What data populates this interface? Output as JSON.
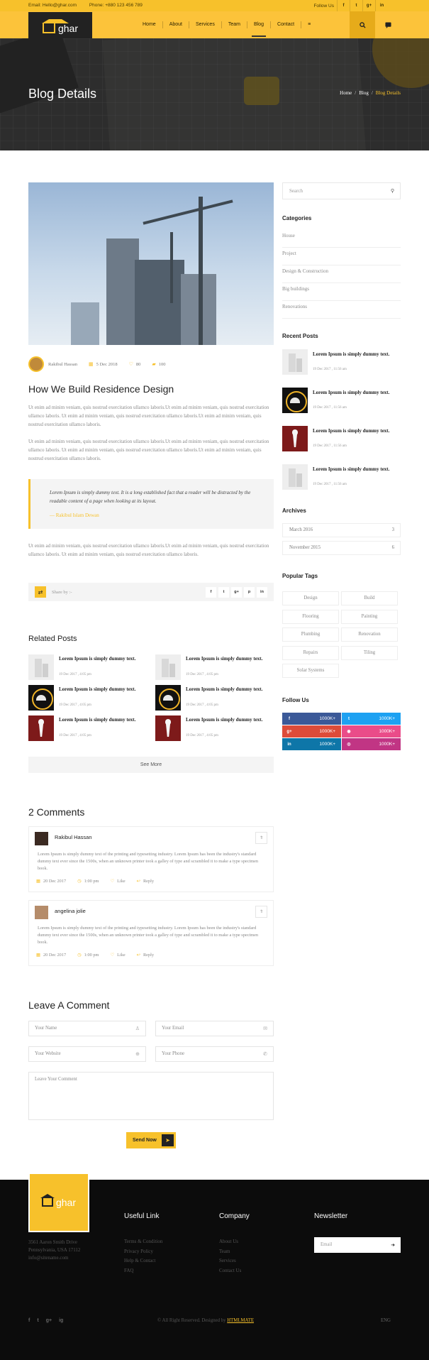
{
  "topbar": {
    "email": "Email: Hello@ghar.com",
    "phone": "Phone: +880 123 456 789",
    "follow": "Follow Us",
    "social": [
      "f",
      "t",
      "g+",
      "in"
    ]
  },
  "brand": {
    "name": "ghar"
  },
  "nav": {
    "items": [
      "Home",
      "About",
      "Services",
      "Team",
      "Blog",
      "Contact"
    ],
    "active": "Blog",
    "more": "≡"
  },
  "hero": {
    "title": "Blog Details",
    "crumbs": [
      "Home",
      "Blog",
      "Blog Details"
    ]
  },
  "post": {
    "author": "Rakibul Hassan",
    "date": "5 Dec 2018",
    "likes": "80",
    "comments": "100",
    "title": "How We Build Residence Design",
    "p1": "Ut enim ad minim veniam, quis nostrud exercitation ullamco laboris.Ut enim ad minim veniam, quis nostrud exercitation ullamco laboris. Ut enim ad minim veniam, quis nostrud exercitation ullamco laboris.Ut enim ad minim veniam, quis nostrud exercitation ullamco laboris.",
    "p2": "Ut enim ad minim veniam, quis nostrud exercitation ullamco laboris.Ut enim ad minim veniam, quis nostrud exercitation ullamco laboris. Ut enim ad minim veniam, quis nostrud exercitation ullamco laboris.Ut enim ad minim veniam, quis nostrud exercitation ullamco laboris.",
    "quote": "Lorem Ipsum is simply dummy text. It is a long established fact that a reader will be distracted by the readable content of a page when looking at its layout.",
    "quote_by": "Rakibul Islam Dewan",
    "p3": "Ut enim ad minim veniam, quis nostrud exercitation ullamco laboris.Ut enim ad minim veniam, quis nostrud exercitation ullamco laboris. Ut enim ad minim veniam, quis nostrud exercitation ullamco laboris.",
    "share_label": "Share by :-",
    "share": [
      "f",
      "t",
      "g+",
      "p",
      "in"
    ]
  },
  "related": {
    "heading": "Related Posts",
    "items": [
      {
        "title": "Lorem Ipsum is simply dummy text.",
        "date": "19 Dec 2017 , 4:05 pm",
        "thumb": "building"
      },
      {
        "title": "Lorem Ipsum is simply dummy text.",
        "date": "19 Dec 2017 , 4:05 pm",
        "thumb": "building"
      },
      {
        "title": "Lorem Ipsum is simply dummy text.",
        "date": "19 Dec 2017 , 4:05 pm",
        "thumb": "hardhat"
      },
      {
        "title": "Lorem Ipsum is simply dummy text.",
        "date": "19 Dec 2017 , 4:05 pm",
        "thumb": "hardhat"
      },
      {
        "title": "Lorem Ipsum is simply dummy text.",
        "date": "19 Dec 2017 , 4:05 pm",
        "thumb": "torch"
      },
      {
        "title": "Lorem Ipsum is simply dummy text.",
        "date": "19 Dec 2017 , 4:05 pm",
        "thumb": "torch"
      }
    ],
    "see_more": "See More"
  },
  "comments": {
    "heading": "2 Comments",
    "items": [
      {
        "name": "Rakibul Hassan",
        "text": "Lorem Ipsum is simply dummy text of the printing and typesetting industry. Lorem Ipsum has been the industry's standard dummy text ever since the 1500s, when an unknown printer took a galley of type and scrambled it to make a type specimen book.",
        "date": "20 Dec 2017",
        "time": "1:00 pm",
        "like": "Like",
        "reply": "Reply"
      },
      {
        "name": "angelina jolie",
        "text": "Lorem Ipsum is simply dummy text of the printing and typesetting industry. Lorem Ipsum has been the industry's standard dummy text ever since the 1500s, when an unknown printer took a galley of type and scrambled it to make a type specimen book.",
        "date": "20 Dec 2017",
        "time": "1:00 pm",
        "like": "Like",
        "reply": "Reply"
      }
    ]
  },
  "form": {
    "heading": "Leave A Comment",
    "name": "Your Name",
    "email": "Your Email",
    "website": "Your Website",
    "phone": "Your Phone",
    "comment": "Leave Your Comment",
    "send": "Send Now"
  },
  "sidebar": {
    "search": "Search",
    "categories_heading": "Categories",
    "categories": [
      "House",
      "Project",
      "Design & Construction",
      "Big buildings",
      "Renovations"
    ],
    "recent_heading": "Recent Posts",
    "recent": [
      {
        "title": "Lorem Ipsum is simply dummy text.",
        "date": "19 Dec 2017 , 11:56 am",
        "thumb": "building"
      },
      {
        "title": "Lorem Ipsum is simply dummy text.",
        "date": "19 Dec 2017 , 11:56 am",
        "thumb": "hardhat"
      },
      {
        "title": "Lorem Ipsum is simply dummy text.",
        "date": "19 Dec 2017 , 11:56 am",
        "thumb": "torch"
      },
      {
        "title": "Lorem Ipsum is simply dummy text.",
        "date": "19 Dec 2017 , 11:56 am",
        "thumb": "building"
      }
    ],
    "archives_heading": "Archives",
    "archives": [
      {
        "label": "March 2016",
        "count": "3"
      },
      {
        "label": "November 2015",
        "count": "6"
      }
    ],
    "tags_heading": "Popular Tags",
    "tags": [
      "Design",
      "Build",
      "Flooring",
      "Painting",
      "Plumbing",
      "Renovation",
      "Repairs",
      "Tiling",
      "Solar Systems"
    ],
    "follow_heading": "Follow Us",
    "follow": [
      {
        "icon": "f",
        "value": "1000K+",
        "color": "#3b5998"
      },
      {
        "icon": "t",
        "value": "1000K+",
        "color": "#1da1f2"
      },
      {
        "icon": "g+",
        "value": "1000K+",
        "color": "#dd4b39"
      },
      {
        "icon": "◉",
        "value": "1000K+",
        "color": "#ea4c89"
      },
      {
        "icon": "in",
        "value": "1000K+",
        "color": "#0e76a8"
      },
      {
        "icon": "◎",
        "value": "1000K+",
        "color": "#c13584"
      }
    ]
  },
  "footer": {
    "address": [
      "3561 Aaron Smith Drive",
      "Pennsylvania, USA 17112",
      "info@sitename.com"
    ],
    "useful_heading": "Useful Link",
    "useful": [
      "Terms & Condition",
      "Privacy Policy",
      "Help & Contact",
      "FAQ"
    ],
    "company_heading": "Company",
    "company": [
      "About Us",
      "Team",
      "Services",
      "Contact Us"
    ],
    "newsletter_heading": "Newsletter",
    "newsletter_placeholder": "Email",
    "social": [
      "f",
      "t",
      "g+",
      "ig"
    ],
    "copyright": "© All Right Reserved. Designed by",
    "designer": "HTMLMATE",
    "lang": "ENG"
  },
  "colors": {
    "accent": "#f7c12b",
    "dark": "#0c0c0c"
  }
}
